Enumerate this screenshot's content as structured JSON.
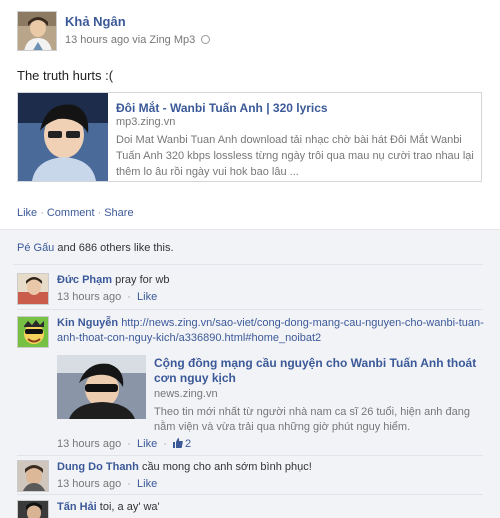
{
  "post": {
    "author": "Khả Ngân",
    "timestamp": "13 hours ago",
    "via": "via",
    "app": "Zing Mp3",
    "status": "The truth hurts :(",
    "share": {
      "title": "Đôi Mắt - Wanbi Tuấn Anh | 320 lyrics",
      "domain": "mp3.zing.vn",
      "description": "Doi Mat Wanbi Tuan Anh download tải nhạc chờ bài hát Đôi Mắt Wanbi Tuấn Anh 320 kbps lossless từng ngày trôi qua mau nụ cười trao nhau lại thêm lo âu rồi ngày vui hok bao lâu ..."
    },
    "actions": {
      "like": "Like",
      "comment": "Comment",
      "share": "Share",
      "separator": "·"
    }
  },
  "likes": {
    "names": "Pé Gấu",
    "rest": " and 686 others like this."
  },
  "comments": [
    {
      "name": "Đức Phạm",
      "text": "pray for wb",
      "time": "13 hours ago",
      "like": "Like"
    },
    {
      "name": "Kin Nguyễn",
      "text_link": "http://news.zing.vn/sao-viet/cong-dong-mang-cau-nguyen-cho-wanbi-tuan-anh-thoat-con-nguy-kich/a336890.html#home_noibat2",
      "attachment": {
        "title": "Cộng đồng mạng cầu nguyện cho Wanbi Tuấn Anh thoát cơn nguy kịch",
        "domain": "news.zing.vn",
        "description": "Theo tin mới nhất từ người nhà nam ca sĩ 26 tuổi, hiện anh đang nằm viện và vừa trải qua những giờ phút nguy hiểm."
      },
      "time": "13 hours ago",
      "like": "Like",
      "like_count": "2"
    },
    {
      "name": "Dung Do Thanh",
      "text": "cầu mong cho anh sớm bình phục!",
      "time": "13 hours ago",
      "like": "Like"
    },
    {
      "name": "Tấn Hải",
      "text": "toi, a ay' wa'"
    }
  ],
  "colors": {
    "link": "#3b5998",
    "meta": "#777777",
    "ufi_bg": "#f2f3f7"
  }
}
